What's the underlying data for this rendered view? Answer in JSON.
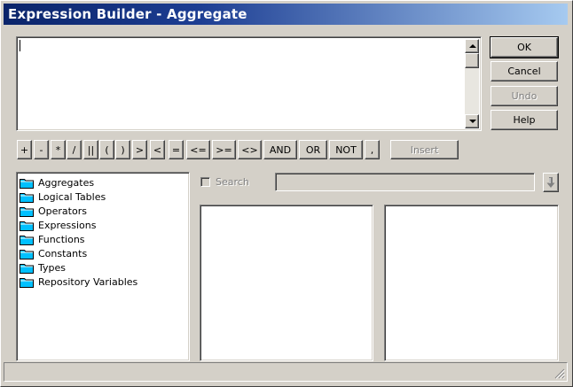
{
  "window": {
    "title": "Expression Builder - Aggregate"
  },
  "buttons": {
    "ok": "OK",
    "cancel": "Cancel",
    "undo": "Undo",
    "help": "Help",
    "insert": "Insert"
  },
  "operators": [
    "+",
    "-",
    "*",
    "/",
    "||",
    "(",
    ")",
    ">",
    "<",
    "=",
    "<=",
    ">=",
    "<>",
    "AND",
    "OR",
    "NOT",
    ","
  ],
  "search": {
    "label": "Search",
    "value": ""
  },
  "tree": {
    "items": [
      {
        "label": "Aggregates"
      },
      {
        "label": "Logical Tables"
      },
      {
        "label": "Operators"
      },
      {
        "label": "Expressions"
      },
      {
        "label": "Functions"
      },
      {
        "label": "Constants"
      },
      {
        "label": "Types"
      },
      {
        "label": "Repository Variables"
      }
    ]
  },
  "expression": {
    "value": ""
  },
  "icons": {
    "folder": "folder-icon",
    "scroll_up": "arrow-up-icon",
    "scroll_down": "arrow-down-icon",
    "search_go": "down-arrow-icon",
    "grip": "size-grip-icon"
  },
  "colors": {
    "titlebar_start": "#0a246a",
    "titlebar_end": "#a6caf0",
    "folder": "#00c0ff"
  }
}
